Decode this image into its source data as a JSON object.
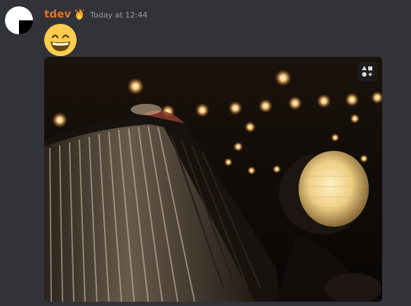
{
  "message": {
    "author": "tdev",
    "author_color": "#e8702a",
    "badge_icon": "fire-badge-icon",
    "timestamp": "Today at 12:44",
    "emoji": "grinning-face-with-smiling-eyes",
    "attachment": {
      "type": "animated-image",
      "subject": "vintage car grille and headlight with string lights",
      "overlay_icon": "gif-shapes-icon"
    }
  },
  "colors": {
    "background": "#313338",
    "timestamp": "#949ba4"
  }
}
